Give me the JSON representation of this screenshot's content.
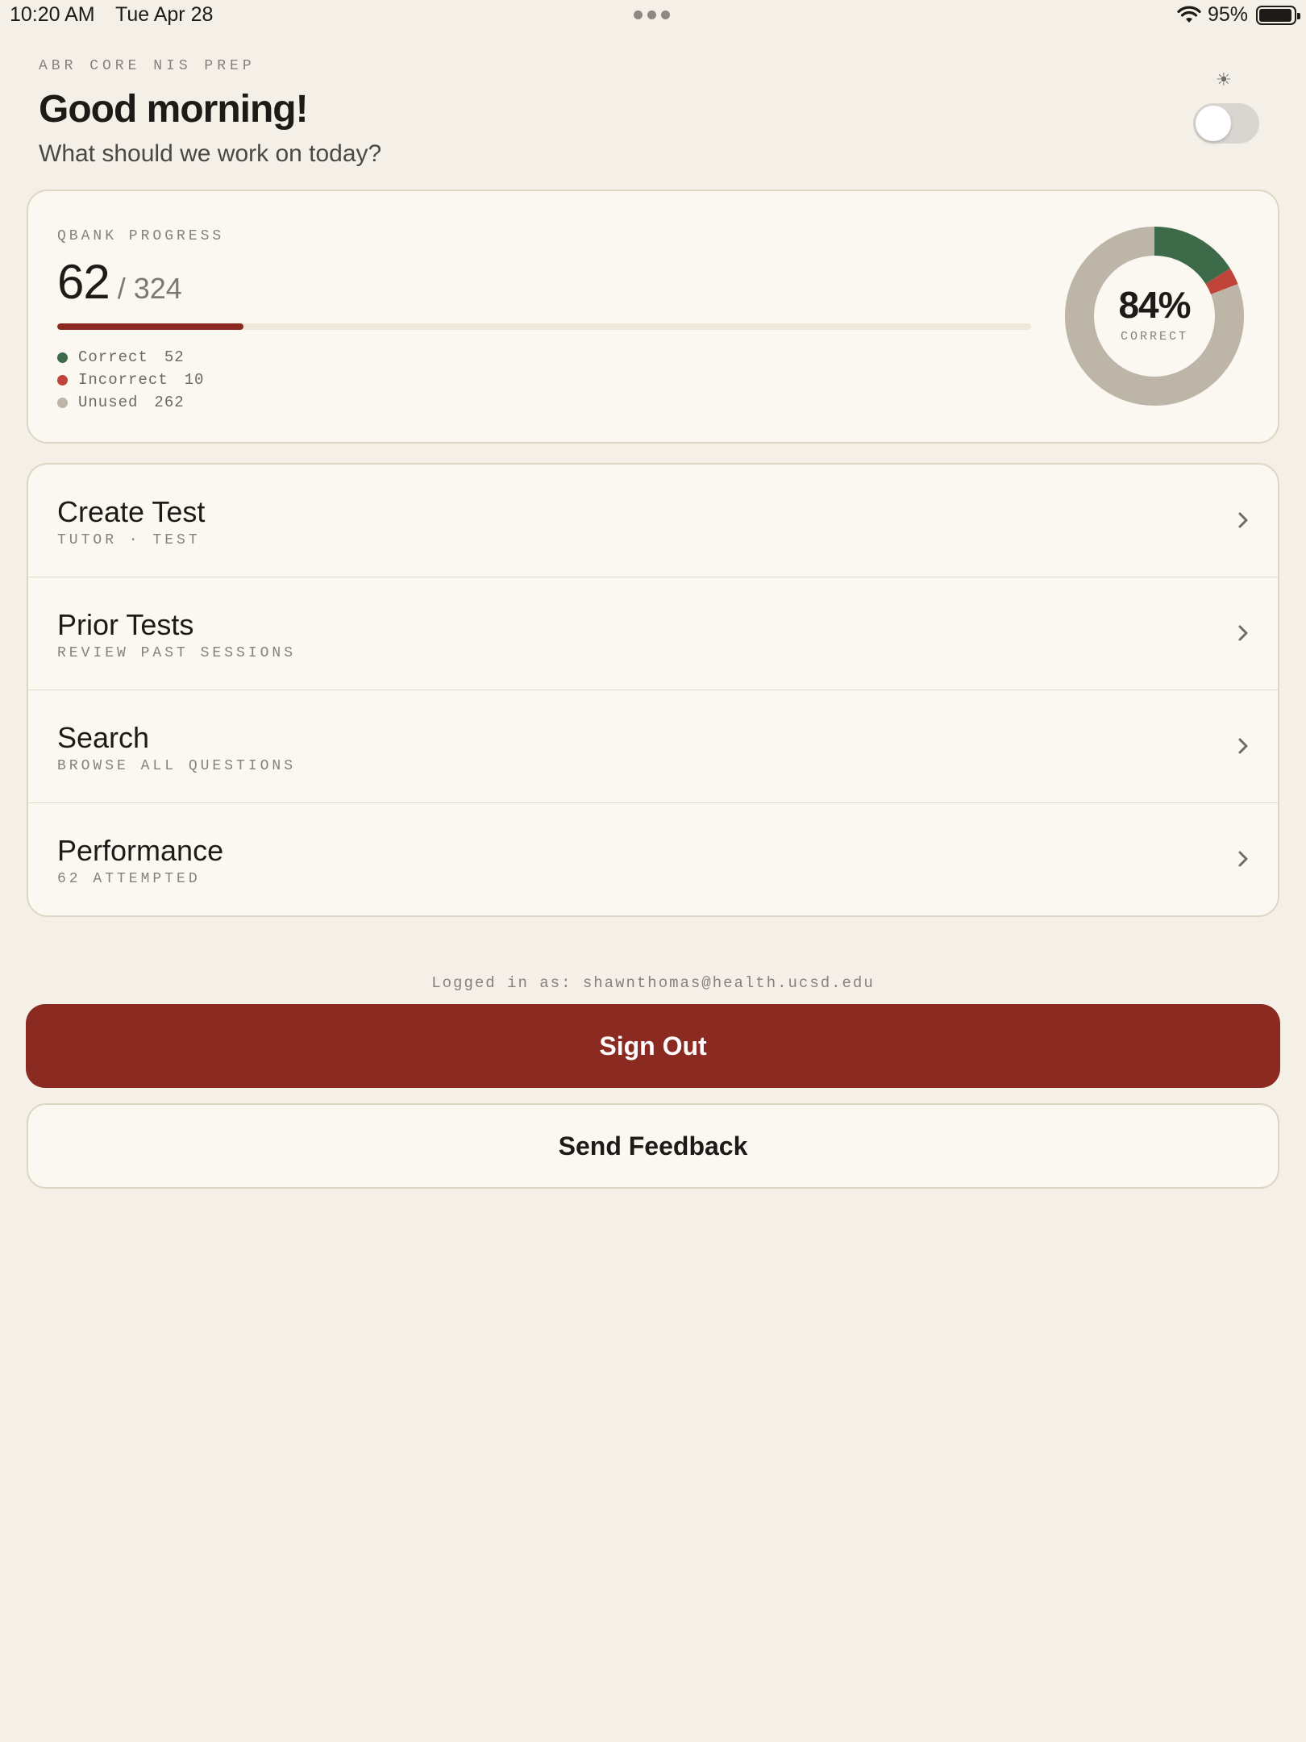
{
  "status_bar": {
    "time": "10:20 AM",
    "date": "Tue Apr 28",
    "battery_pct": "95%",
    "battery_level": 0.95
  },
  "header": {
    "eyebrow": "ABR CORE NIS PREP",
    "greeting": "Good morning!",
    "subtitle": "What should we work on today?",
    "theme_toggle_on": false
  },
  "progress": {
    "label": "QBANK PROGRESS",
    "count": "62",
    "total": "/ 324",
    "fraction_complete": 0.191,
    "legend": [
      {
        "label": "Correct",
        "value": "52",
        "color": "#3d6b4a"
      },
      {
        "label": "Incorrect",
        "value": "10",
        "color": "#c0443a"
      },
      {
        "label": "Unused",
        "value": "262",
        "color": "#bdb5a8"
      }
    ],
    "donut_pct": "84%",
    "donut_label": "CORRECT"
  },
  "menu": [
    {
      "title": "Create Test",
      "subtitle": "TUTOR · TEST"
    },
    {
      "title": "Prior Tests",
      "subtitle": "REVIEW PAST SESSIONS"
    },
    {
      "title": "Search",
      "subtitle": "BROWSE ALL QUESTIONS"
    },
    {
      "title": "Performance",
      "subtitle": "62 ATTEMPTED"
    }
  ],
  "footer": {
    "logged_in": "Logged in as: shawnthomas@health.ucsd.edu",
    "sign_out": "Sign Out",
    "feedback": "Send Feedback"
  },
  "colors": {
    "accent": "#8a2a20",
    "background": "#f4efe7",
    "card": "#fbf8f1"
  }
}
